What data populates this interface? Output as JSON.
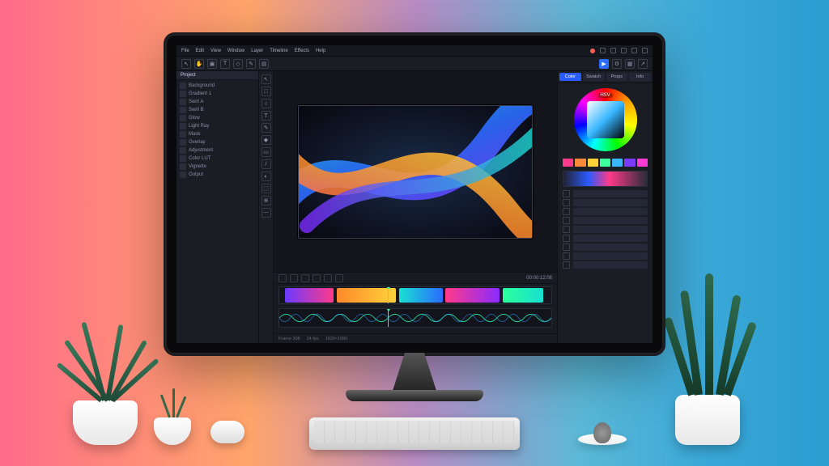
{
  "menubar": {
    "items": [
      "File",
      "Edit",
      "View",
      "Window",
      "Layer",
      "Timeline",
      "Effects",
      "Help"
    ]
  },
  "toolbar": {
    "items": [
      {
        "name": "pointer-icon",
        "glyph": "↖"
      },
      {
        "name": "hand-icon",
        "glyph": "✋"
      },
      {
        "name": "crop-icon",
        "glyph": "▣"
      },
      {
        "name": "text-icon",
        "glyph": "T"
      },
      {
        "name": "shape-icon",
        "glyph": "◇"
      },
      {
        "name": "pen-icon",
        "glyph": "✎"
      },
      {
        "name": "bucket-icon",
        "glyph": "▤"
      }
    ],
    "right": [
      {
        "name": "play-icon",
        "glyph": "▶",
        "accent": true
      },
      {
        "name": "settings-icon",
        "glyph": "⚙"
      },
      {
        "name": "grid-icon",
        "glyph": "▦"
      },
      {
        "name": "export-icon",
        "glyph": "↗"
      }
    ]
  },
  "project": {
    "panel_title": "Project",
    "layers": [
      "Background",
      "Gradient 1",
      "Swirl A",
      "Swirl B",
      "Glow",
      "Light Ray",
      "Mask",
      "Overlay",
      "Adjustment",
      "Color LUT",
      "Vignette",
      "Output"
    ]
  },
  "tool_strip": [
    "↖",
    "□",
    "○",
    "T",
    "✎",
    "◆",
    "▭",
    "/",
    "◐",
    "⬚",
    "⊕",
    "⋯"
  ],
  "color": {
    "mode_label": "HSV"
  },
  "right_tabs": [
    "Color",
    "Swatch",
    "Props",
    "Info"
  ],
  "swatches": [
    "#ff3a8a",
    "#ff8a3a",
    "#ffd23a",
    "#3aff9c",
    "#3ab6ff",
    "#7a3aff",
    "#ff3ad2"
  ],
  "timeline": {
    "tools": [
      "▶",
      "⏸",
      "⏮",
      "⏭",
      "⟲",
      "✂",
      "🔍"
    ],
    "timecode": "00:00:12:08",
    "footer": [
      "Frame 308",
      "24 fps",
      "1920×1080"
    ]
  }
}
